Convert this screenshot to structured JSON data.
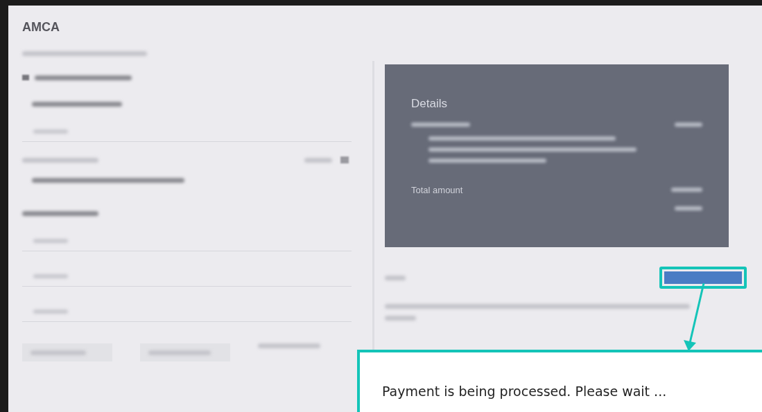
{
  "app": {
    "title": "AMCA"
  },
  "details_card": {
    "title": "Details",
    "total_label": "Total amount"
  },
  "callout": {
    "message": "Payment is being processed. Please wait ..."
  }
}
